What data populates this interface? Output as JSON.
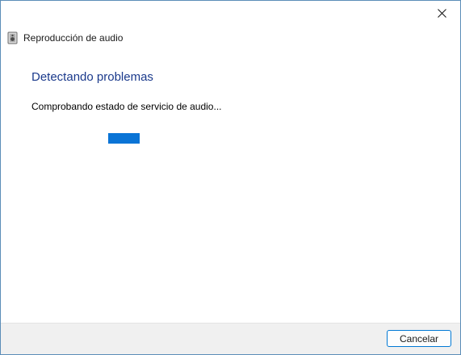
{
  "window": {
    "title": "Reproducción de audio",
    "close_icon": "close-icon",
    "app_icon": "speaker-troubleshooter-icon"
  },
  "main": {
    "heading": "Detectando problemas",
    "status_text": "Comprobando estado de servicio de audio...",
    "progress": {
      "type": "indeterminate",
      "chunk_position": 0.6
    }
  },
  "footer": {
    "cancel_label": "Cancelar"
  },
  "colors": {
    "heading": "#1b3a8c",
    "progress": "#0a74d6",
    "window_border": "#5b8db8",
    "button_border": "#0078d4",
    "footer_bg": "#f0f0f0"
  }
}
